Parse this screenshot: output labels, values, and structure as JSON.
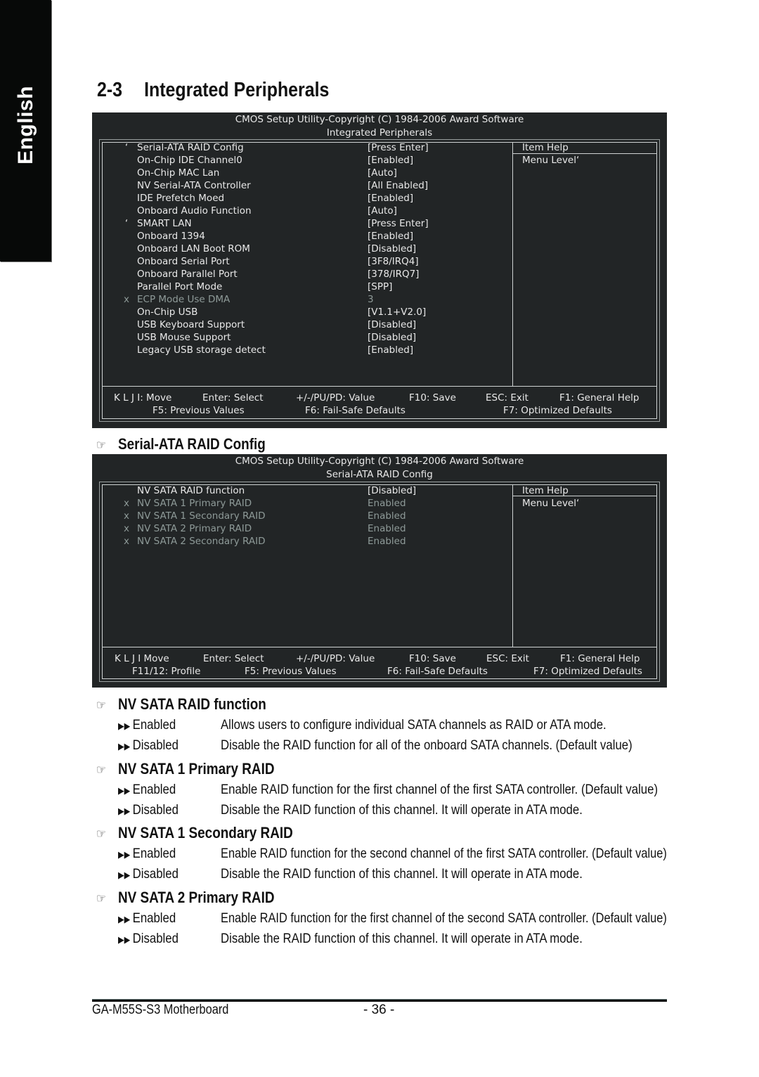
{
  "side_tab": "English",
  "page": {
    "section_number": "2-3",
    "section_title": "Integrated Peripherals"
  },
  "bios1": {
    "header_line1": "CMOS Setup Utility-Copyright (C) 1984-2006 Award Software",
    "header_line2": "Integrated Peripherals",
    "items": [
      {
        "mark": "‘",
        "label": "Serial-ATA RAID Config",
        "value": "[Press Enter]",
        "disabled": false
      },
      {
        "mark": "",
        "label": "On-Chip IDE Channel0",
        "value": "[Enabled]",
        "disabled": false
      },
      {
        "mark": "",
        "label": "On-Chip MAC Lan",
        "value": "[Auto]",
        "disabled": false
      },
      {
        "mark": "",
        "label": "NV Serial-ATA Controller",
        "value": "[All Enabled]",
        "disabled": false
      },
      {
        "mark": "",
        "label": "IDE Prefetch Moed",
        "value": "[Enabled]",
        "disabled": false
      },
      {
        "mark": "",
        "label": "Onboard Audio Function",
        "value": "[Auto]",
        "disabled": false
      },
      {
        "mark": "‘",
        "label": "SMART LAN",
        "value": "[Press Enter]",
        "disabled": false
      },
      {
        "mark": "",
        "label": "Onboard 1394",
        "value": "[Enabled]",
        "disabled": false
      },
      {
        "mark": "",
        "label": "Onboard LAN Boot ROM",
        "value": "[Disabled]",
        "disabled": false
      },
      {
        "mark": "",
        "label": "Onboard Serial Port",
        "value": "[3F8/IRQ4]",
        "disabled": false
      },
      {
        "mark": "",
        "label": "Onboard Parallel Port",
        "value": "[378/IRQ7]",
        "disabled": false
      },
      {
        "mark": "",
        "label": "Parallel Port Mode",
        "value": "[SPP]",
        "disabled": false
      },
      {
        "mark": "x",
        "label": "ECP Mode Use DMA",
        "value": "3",
        "disabled": true
      },
      {
        "mark": "",
        "label": "On-Chip USB",
        "value": "[V1.1+V2.0]",
        "disabled": false
      },
      {
        "mark": "",
        "label": "USB Keyboard Support",
        "value": "[Disabled]",
        "disabled": false
      },
      {
        "mark": "",
        "label": "USB Mouse Support",
        "value": "[Disabled]",
        "disabled": false
      },
      {
        "mark": "",
        "label": "Legacy USB storage detect",
        "value": "[Enabled]",
        "disabled": false
      }
    ],
    "help_title": "Item Help",
    "help_text": "Menu Level‘",
    "footer_row1": [
      "K L J I: Move",
      "Enter: Select",
      "+/-/PU/PD: Value",
      "F10: Save",
      "ESC: Exit",
      "F1: General Help"
    ],
    "footer_row2": [
      "F5: Previous Values",
      "F6: Fail-Safe Defaults",
      "F7: Optimized Defaults"
    ]
  },
  "sub_heading": "Serial-ATA RAID Config",
  "bios2": {
    "header_line1": "CMOS Setup Utility-Copyright (C) 1984-2006 Award Software",
    "header_line2": "Serial-ATA RAID Config",
    "items": [
      {
        "mark": "",
        "label": "NV SATA RAID function",
        "value": "[Disabled]",
        "disabled": false
      },
      {
        "mark": "x",
        "label": "NV SATA 1 Primary RAID",
        "value": "Enabled",
        "disabled": true
      },
      {
        "mark": "x",
        "label": "NV SATA 1 Secondary RAID",
        "value": "Enabled",
        "disabled": true
      },
      {
        "mark": "x",
        "label": "NV SATA 2 Primary RAID",
        "value": "Enabled",
        "disabled": true
      },
      {
        "mark": "x",
        "label": "NV SATA 2 Secondary RAID",
        "value": "Enabled",
        "disabled": true
      }
    ],
    "help_title": "Item Help",
    "help_text": "Menu Level‘",
    "footer_row1": [
      "K L J I Move",
      "Enter: Select",
      "+/-/PU/PD: Value",
      "F10: Save",
      "ESC: Exit",
      "F1: General Help"
    ],
    "footer_row2": [
      "F11/12: Profile",
      "F5: Previous Values",
      "F6: Fail-Safe Defaults",
      "F7: Optimized Defaults"
    ]
  },
  "descriptions": [
    {
      "heading": "NV SATA RAID function",
      "options": [
        {
          "name": "Enabled",
          "text": "Allows users to configure individual SATA channels as RAID or ATA mode."
        },
        {
          "name": "Disabled",
          "text": "Disable the RAID function for all of the onboard SATA channels. (Default value)"
        }
      ]
    },
    {
      "heading": "NV SATA 1 Primary RAID",
      "options": [
        {
          "name": "Enabled",
          "text": "Enable RAID function for the first channel of the first SATA controller. (Default value)"
        },
        {
          "name": "Disabled",
          "text": "Disable the RAID function of this channel. It will operate in ATA mode."
        }
      ]
    },
    {
      "heading": "NV SATA 1 Secondary RAID",
      "options": [
        {
          "name": "Enabled",
          "text": "Enable RAID function for the second channel of the first SATA controller. (Default value)"
        },
        {
          "name": "Disabled",
          "text": "Disable the RAID function of this channel. It will operate in ATA mode."
        }
      ]
    },
    {
      "heading": "NV SATA 2 Primary RAID",
      "options": [
        {
          "name": "Enabled",
          "text": "Enable RAID function for the first channel of the second SATA controller. (Default value)"
        },
        {
          "name": "Disabled",
          "text": "Disable the RAID function of this channel. It will operate in ATA mode."
        }
      ]
    }
  ],
  "icons": {
    "hand": "☞",
    "double_arrow": "▶▶"
  },
  "footer": {
    "product": "GA-M55S-S3 Motherboard",
    "page_number": "- 36 -"
  }
}
